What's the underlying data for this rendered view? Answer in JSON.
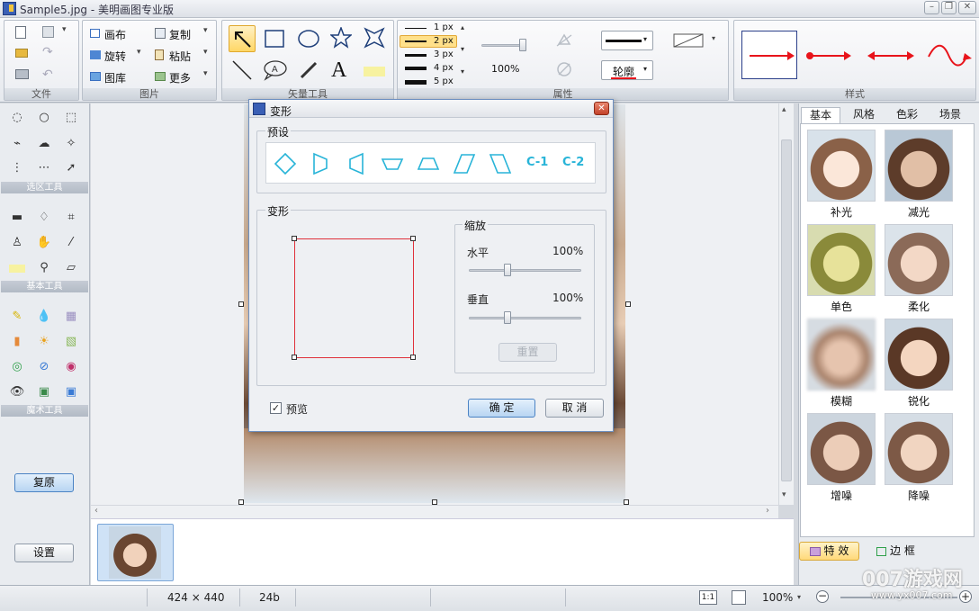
{
  "window": {
    "title": "Sample5.jpg - 美明画图专业版",
    "controls": [
      "minimize",
      "restore",
      "close"
    ]
  },
  "ribbon": {
    "file_group": {
      "label": "文件"
    },
    "picture_group": {
      "label": "图片",
      "canvas": "画布",
      "copy": "复制",
      "rotate": "旋转",
      "paste": "粘贴",
      "gallery": "图库",
      "more": "更多"
    },
    "vector_group": {
      "label": "矢量工具",
      "text_tool": "A"
    },
    "width_options": [
      "1 px",
      "2 px",
      "3 px",
      "4 px",
      "5 px"
    ],
    "selected_width": "2 px",
    "opacity": "100%",
    "attributes_label": "属性",
    "outline_label": "轮廓",
    "style_label": "样式"
  },
  "left_tools": {
    "selection_label": "选区工具",
    "basic_label": "基本工具",
    "magic_label": "魔术工具",
    "restore_button": "复原",
    "settings_button": "设置"
  },
  "right_panel": {
    "tabs": [
      "基本",
      "风格",
      "色彩",
      "场景"
    ],
    "effects": [
      "补光",
      "减光",
      "单色",
      "柔化",
      "模糊",
      "锐化",
      "增噪",
      "降噪"
    ],
    "effects_button": "特 效",
    "border_button": "边 框"
  },
  "status": {
    "dimensions": "424 × 440",
    "bit_depth": "24b",
    "ratio_button": "1:1",
    "zoom": "100%"
  },
  "dialog": {
    "title": "变形",
    "presets_label": "预设",
    "presets": [
      "C-1",
      "C-2"
    ],
    "transform_label": "变形",
    "scale_label": "缩放",
    "horizontal_label": "水平",
    "horizontal_value": "100%",
    "vertical_label": "垂直",
    "vertical_value": "100%",
    "reset_button": "重置",
    "preview_label": "预览",
    "preview_checked": true,
    "ok_button": "确 定",
    "cancel_button": "取 消"
  },
  "watermark": {
    "main": "007游戏网",
    "url": "www.yx007.com"
  },
  "colors": {
    "accent": "#e8141b",
    "preset_cyan": "#28b4d8",
    "selection": "#4b83c4"
  }
}
